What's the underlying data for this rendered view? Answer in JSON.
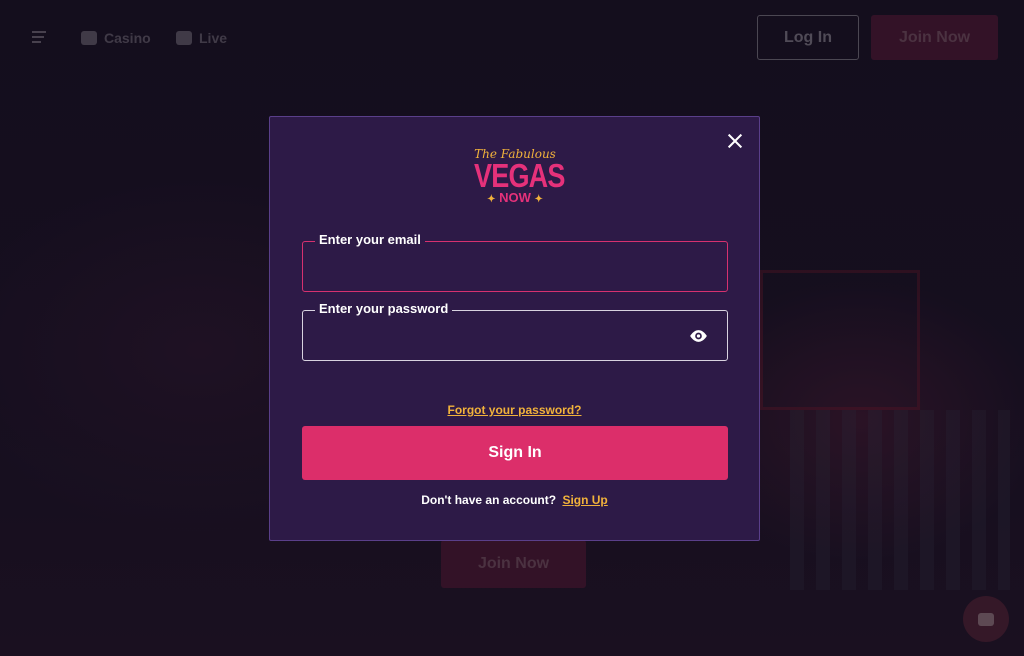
{
  "header": {
    "nav": [
      {
        "label": "Casino",
        "icon": "cherries-icon"
      },
      {
        "label": "Live",
        "icon": "cards-icon"
      }
    ],
    "login_label": "Log In",
    "join_label": "Join Now"
  },
  "background": {
    "join_label": "Join Now"
  },
  "modal": {
    "logo": {
      "script": "The Fabulous",
      "main": "VEGAS",
      "sub": "NOW"
    },
    "email": {
      "label": "Enter your email",
      "value": ""
    },
    "password": {
      "label": "Enter your password",
      "value": ""
    },
    "forgot_label": "Forgot your password?",
    "signin_label": "Sign In",
    "signup_prompt": "Don't have an account?",
    "signup_link": "Sign Up"
  },
  "colors": {
    "accent": "#dc2e6a",
    "gold": "#f1b23b",
    "modal_bg": "#2d1a47"
  }
}
